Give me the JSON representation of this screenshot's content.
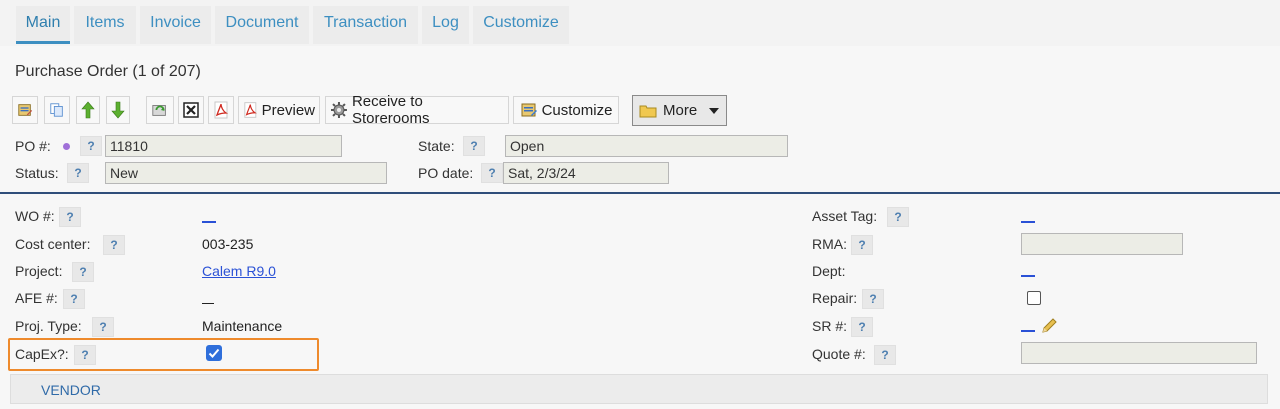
{
  "tabs": [
    {
      "label": "Main",
      "active": true
    },
    {
      "label": "Items"
    },
    {
      "label": "Invoice"
    },
    {
      "label": "Document"
    },
    {
      "label": "Transaction"
    },
    {
      "label": "Log"
    },
    {
      "label": "Customize"
    }
  ],
  "page_title": "Purchase Order (1 of 207)",
  "toolbar": {
    "preview_label": "Preview",
    "receive_label": "Receive to Storerooms",
    "customize_label": "Customize",
    "more_label": "More"
  },
  "header": {
    "po_label": "PO #:",
    "po_value": "11810",
    "status_label": "Status:",
    "status_value": "New",
    "state_label": "State:",
    "state_value": "Open",
    "po_date_label": "PO date:",
    "po_date_value": "Sat, 2/3/24"
  },
  "help_glyph": "?",
  "left_fields": {
    "wo_label": "WO #:",
    "cost_center_label": "Cost center:",
    "cost_center_value": "003-235",
    "project_label": "Project:",
    "project_value": "Calem R9.0",
    "afe_label": "AFE #:",
    "proj_type_label": "Proj. Type:",
    "proj_type_value": "Maintenance",
    "capex_label": "CapEx?:",
    "capex_checked": true
  },
  "right_fields": {
    "asset_tag_label": "Asset Tag:",
    "rma_label": "RMA:",
    "rma_value": "",
    "dept_label": "Dept:",
    "repair_label": "Repair:",
    "repair_checked": false,
    "sr_label": "SR #:",
    "quote_label": "Quote #:",
    "quote_value": ""
  },
  "section": {
    "vendor_label": "VENDOR"
  },
  "colors": {
    "accent": "#3d8fc1",
    "link": "#2a51d6",
    "highlight": "#ee8a2c",
    "divider": "#2f4e7a",
    "checkbox": "#2f6fdb"
  }
}
